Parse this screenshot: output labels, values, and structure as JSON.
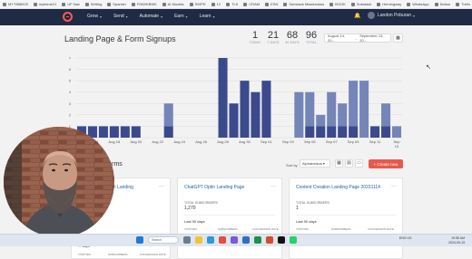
{
  "bookmarks": [
    "MYT888925",
    "myteime21",
    "UF Nav",
    "Writing",
    "Spanish",
    "FNW/KBWK",
    "AI Models",
    "SWPD",
    "12",
    "TLS",
    "CRAM",
    "ESN",
    "Substack Masterclass",
    "BOOK",
    "Substack",
    "Hemingway",
    "WhatsApp",
    "Notion",
    "Trello",
    "Root Cause Remm..."
  ],
  "nav": {
    "menu": [
      "Grow",
      "Send",
      "Automate",
      "Earn",
      "Learn"
    ],
    "user_name": "Landon Poburan"
  },
  "header": {
    "title": "Landing Page & Form Signups",
    "stats": [
      {
        "value": "1",
        "label": "TODAY"
      },
      {
        "value": "21",
        "label": "7 DAYS"
      },
      {
        "value": "68",
        "label": "30 DAYS"
      },
      {
        "value": "96",
        "label": "TOTAL"
      }
    ],
    "date_from": "August 14, 20...",
    "date_to": "September 13, 20...",
    "date_sep": "–"
  },
  "chart_data": {
    "type": "bar",
    "stacked": true,
    "ylim": [
      0,
      7
    ],
    "y_ticks": [
      "0",
      "1",
      "2",
      "3",
      "4",
      "5",
      "6",
      "7"
    ],
    "x_tick_labels": [
      "Aug 16",
      "Aug 18",
      "Aug 20",
      "Aug 22",
      "Aug 24",
      "Aug 26",
      "Aug 28",
      "Aug 30",
      "Sep 01",
      "Sep 03",
      "Sep 05",
      "Sep 07",
      "Sep 09",
      "Sep 11",
      "Sep 13"
    ],
    "categories": [
      "Aug 15",
      "Aug 16",
      "Aug 17",
      "Aug 18",
      "Aug 19",
      "Aug 20",
      "Aug 21",
      "Aug 22",
      "Aug 23",
      "Aug 24",
      "Aug 25",
      "Aug 26",
      "Aug 27",
      "Aug 28",
      "Aug 29",
      "Aug 30",
      "Aug 31",
      "Sep 01",
      "Sep 02",
      "Sep 03",
      "Sep 04",
      "Sep 05",
      "Sep 06",
      "Sep 07",
      "Sep 08",
      "Sep 09",
      "Sep 10",
      "Sep 11",
      "Sep 12",
      "Sep 13"
    ],
    "series": [
      {
        "values": [
          1,
          1,
          1,
          1,
          1,
          1,
          0,
          0,
          1,
          0,
          0,
          0,
          0,
          7,
          3,
          5,
          4,
          5,
          0,
          0,
          0,
          1,
          1,
          1,
          1,
          1,
          0,
          1,
          1,
          0
        ],
        "color": "#3b4a8c"
      },
      {
        "values": [
          0,
          0,
          0,
          0,
          0,
          0,
          0,
          0,
          2,
          0,
          0,
          0,
          0,
          0,
          0,
          0,
          0,
          0,
          0,
          0,
          4,
          3,
          1,
          3,
          2,
          4,
          5,
          0,
          2,
          1
        ],
        "color": "#7585b8"
      }
    ],
    "grid": true
  },
  "section": {
    "title": "es & Forms",
    "sort_label": "Sort by",
    "sort_value": "Alphabetical",
    "create_label": "+ Create new"
  },
  "cards": [
    {
      "title": "...gen Launch Plan Landing",
      "subscribers_label": "TOTAL SUBSCRIBERS",
      "subscribers": "",
      "range": "... days",
      "cols": [
        "VISITORS",
        "SUBSCRIBERS",
        "CONVERSION RATE"
      ]
    },
    {
      "title": "ChatGPT Optin Landing Page",
      "subscribers_label": "TOTAL SUBSCRIBERS",
      "subscribers": "1,270",
      "range": "Last 90 days",
      "cols": [
        "VISITORS",
        "SUBSCRIBERS",
        "CONVERSION RATE"
      ]
    },
    {
      "title": "Content Creation Landing Page 20231114",
      "subscribers_label": "TOTAL SUBSCRIBERS",
      "subscribers": "1",
      "range": "Last 90 days",
      "cols": [
        "VISITORS",
        "SUBSCRIBERS",
        "CONVERSION RATE"
      ]
    }
  ],
  "taskbar": {
    "weather": "",
    "search": "Search",
    "tray": "ENG US",
    "time": "10:55 AM",
    "date": "2024-09-13"
  },
  "colors": {
    "nav_bg": "#1f2a44",
    "accent": "#e9584d",
    "bar_dark": "#3b4a8c",
    "bar_light": "#7585b8"
  }
}
